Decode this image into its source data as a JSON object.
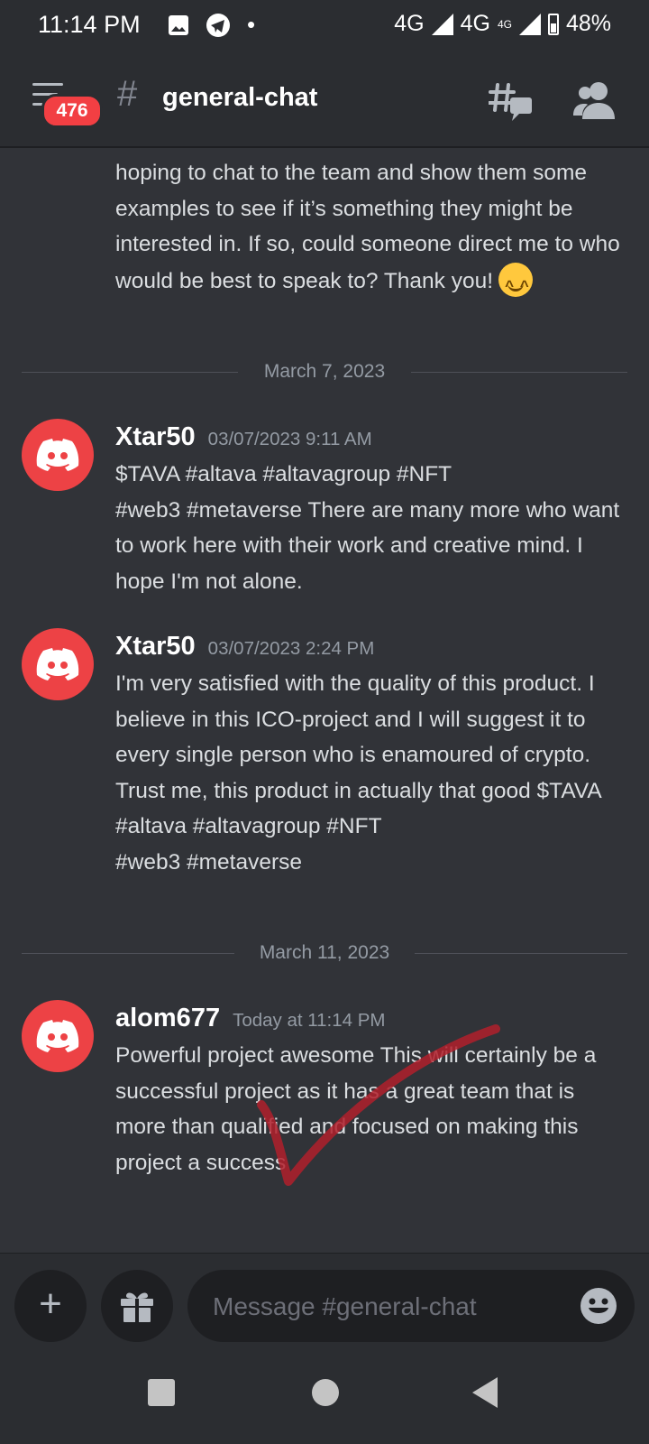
{
  "status_bar": {
    "time": "11:14 PM",
    "dot": "•",
    "network_1": "4G",
    "network_2": "4G",
    "network_2_sup": "4G",
    "battery": "48%"
  },
  "header": {
    "notification_count": "476",
    "channel_hash": "#",
    "channel_name": "general-chat"
  },
  "messages": {
    "continued_text": "hoping to chat to the team and show them some examples to see if it’s something they might be interested in. If so, could someone direct me to who would be best to speak to? Thank you!",
    "dividers": [
      "March 7, 2023",
      "March 11, 2023"
    ],
    "items": [
      {
        "author": "Xtar50",
        "timestamp": "03/07/2023 9:11 AM",
        "text": "$TAVA #altava #altavagroup #NFT\n#web3 #metaverse  There are many more who want to work here with their work and creative mind. I hope I'm not alone."
      },
      {
        "author": "Xtar50",
        "timestamp": "03/07/2023 2:24 PM",
        "text": "I'm very satisfied with the quality of this product. I believe in this ICO-project and I will suggest it to every single person who is enamoured of crypto. Trust me, this product in actually that good $TAVA #altava #altavagroup #NFT\n#web3 #metaverse"
      },
      {
        "author": "alom677",
        "timestamp": "Today at 11:14 PM",
        "text": "Powerful project awesome This will certainly be a successful project as it has a great team that is more than qualified and focused on making this project a success"
      }
    ]
  },
  "composer": {
    "plus": "+",
    "placeholder": "Message #general-chat"
  },
  "colors": {
    "background": "#313338",
    "avatar": "#ed4245",
    "badge": "#f23f43",
    "checkmark": "#b0202c"
  },
  "icons": [
    "image-icon",
    "telegram-icon",
    "signal-icon",
    "battery-icon",
    "menu-icon",
    "threads-icon",
    "members-icon",
    "discord-avatar-icon",
    "plus-icon",
    "gift-icon",
    "emoji-icon",
    "home-icon",
    "back-icon",
    "recents-icon"
  ]
}
